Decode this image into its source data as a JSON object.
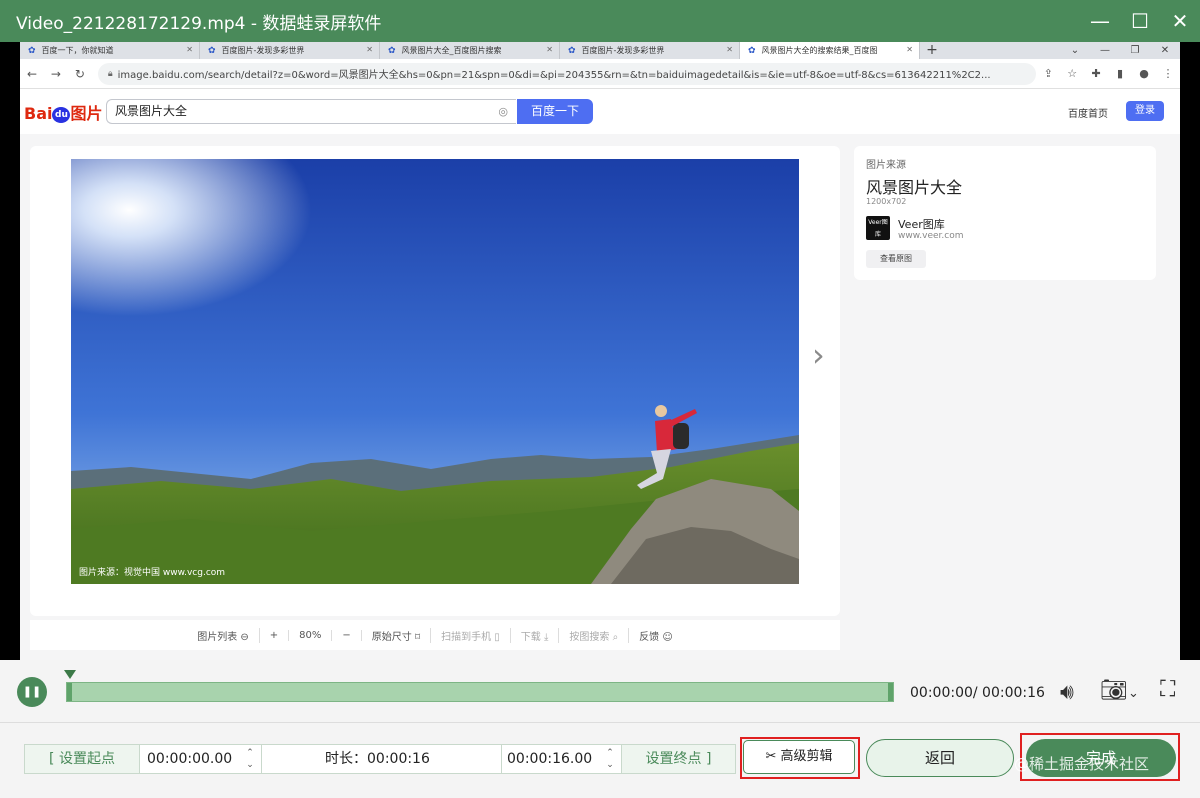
{
  "app": {
    "title": "Video_221228172129.mp4  -  数据蛙录屏软件",
    "theme_color": "#4a8a5a"
  },
  "browser": {
    "tabs": [
      {
        "label": "百度一下，你就知道",
        "active": false
      },
      {
        "label": "百度图片-发现多彩世界",
        "active": false
      },
      {
        "label": "风景图片大全_百度图片搜索",
        "active": false
      },
      {
        "label": "百度图片-发现多彩世界",
        "active": false
      },
      {
        "label": "风景图片大全的搜索结果_百度图",
        "active": true
      }
    ],
    "url": "image.baidu.com/search/detail?z=0&word=风景图片大全&hs=0&pn=21&spn=0&di=&pi=204355&rn=&tn=baiduimagedetail&is=&ie=utf-8&oe=utf-8&cs=613642211%2C2..."
  },
  "baidu": {
    "logo": "Bai",
    "logo_du": "du",
    "logo_suffix": "图片",
    "search_value": "风景图片大全",
    "search_button": "百度一下",
    "home_link": "百度首页",
    "login_button": "登录"
  },
  "viewer": {
    "credit": "图片来源：视觉中国 www.vcg.com",
    "toolbar": [
      "图片列表 ⊖",
      "+",
      "80%",
      "−",
      "原始尺寸 ⌑",
      "扫描到手机 ▯",
      "下载 ⤓",
      "按图搜索 ⌕",
      "反馈 ☺"
    ]
  },
  "side_panel": {
    "label": "图片来源",
    "title": "风景图片大全",
    "dimensions": "1200x702",
    "source_logo": "Veer图库",
    "source_name": "Veer图库",
    "source_url": "www.veer.com",
    "view_source": "查看原图"
  },
  "player": {
    "timecode": "00:00:00/ 00:00:16",
    "progress": 0
  },
  "editor": {
    "set_start": "设置起点",
    "start_time": "00:00:00.00",
    "duration": "时长：00:00:16",
    "end_time": "00:00:16.00",
    "set_end": "设置终点",
    "advanced_edit": "高级剪辑",
    "back": "返回",
    "done": "完成",
    "watermark": "@稀土掘金技术社区"
  }
}
